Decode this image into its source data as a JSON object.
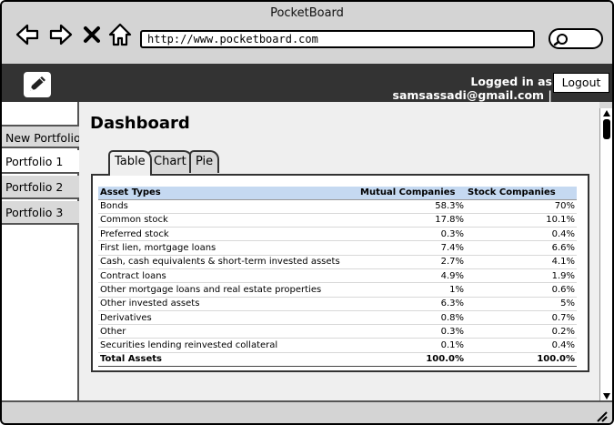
{
  "window": {
    "title": "PocketBoard"
  },
  "browser": {
    "url": "http://www.pocketboard.com"
  },
  "header": {
    "logged_in_text": "Logged in as samsassadi@gmail.com |",
    "logout_label": "Logout"
  },
  "sidebar": {
    "items": [
      {
        "label": "New Portfolio"
      },
      {
        "label": "Portfolio 1"
      },
      {
        "label": "Portfolio 2"
      },
      {
        "label": "Portfolio 3"
      }
    ]
  },
  "main": {
    "title": "Dashboard",
    "tabs": [
      {
        "label": "Table"
      },
      {
        "label": "Chart"
      },
      {
        "label": "Pie"
      }
    ],
    "table": {
      "headers": [
        "Asset Types",
        "Mutual Companies",
        "Stock Companies"
      ],
      "rows": [
        [
          "Bonds",
          "58.3%",
          "70%"
        ],
        [
          "Common stock",
          "17.8%",
          "10.1%"
        ],
        [
          "Preferred stock",
          "0.3%",
          "0.4%"
        ],
        [
          "First lien, mortgage loans",
          "7.4%",
          "6.6%"
        ],
        [
          "Cash, cash equivalents & short-term invested assets",
          "2.7%",
          "4.1%"
        ],
        [
          "Contract loans",
          "4.9%",
          "1.9%"
        ],
        [
          "Other mortgage loans and real estate properties",
          "1%",
          "0.6%"
        ],
        [
          "Other invested assets",
          "6.3%",
          "5%"
        ],
        [
          "Derivatives",
          "0.8%",
          "0.7%"
        ],
        [
          "Other",
          "0.3%",
          "0.2%"
        ],
        [
          "Securities lending reinvested collateral",
          "0.1%",
          "0.4%"
        ]
      ],
      "total": [
        "Total Assets",
        "100.0%",
        "100.0%"
      ]
    }
  }
}
